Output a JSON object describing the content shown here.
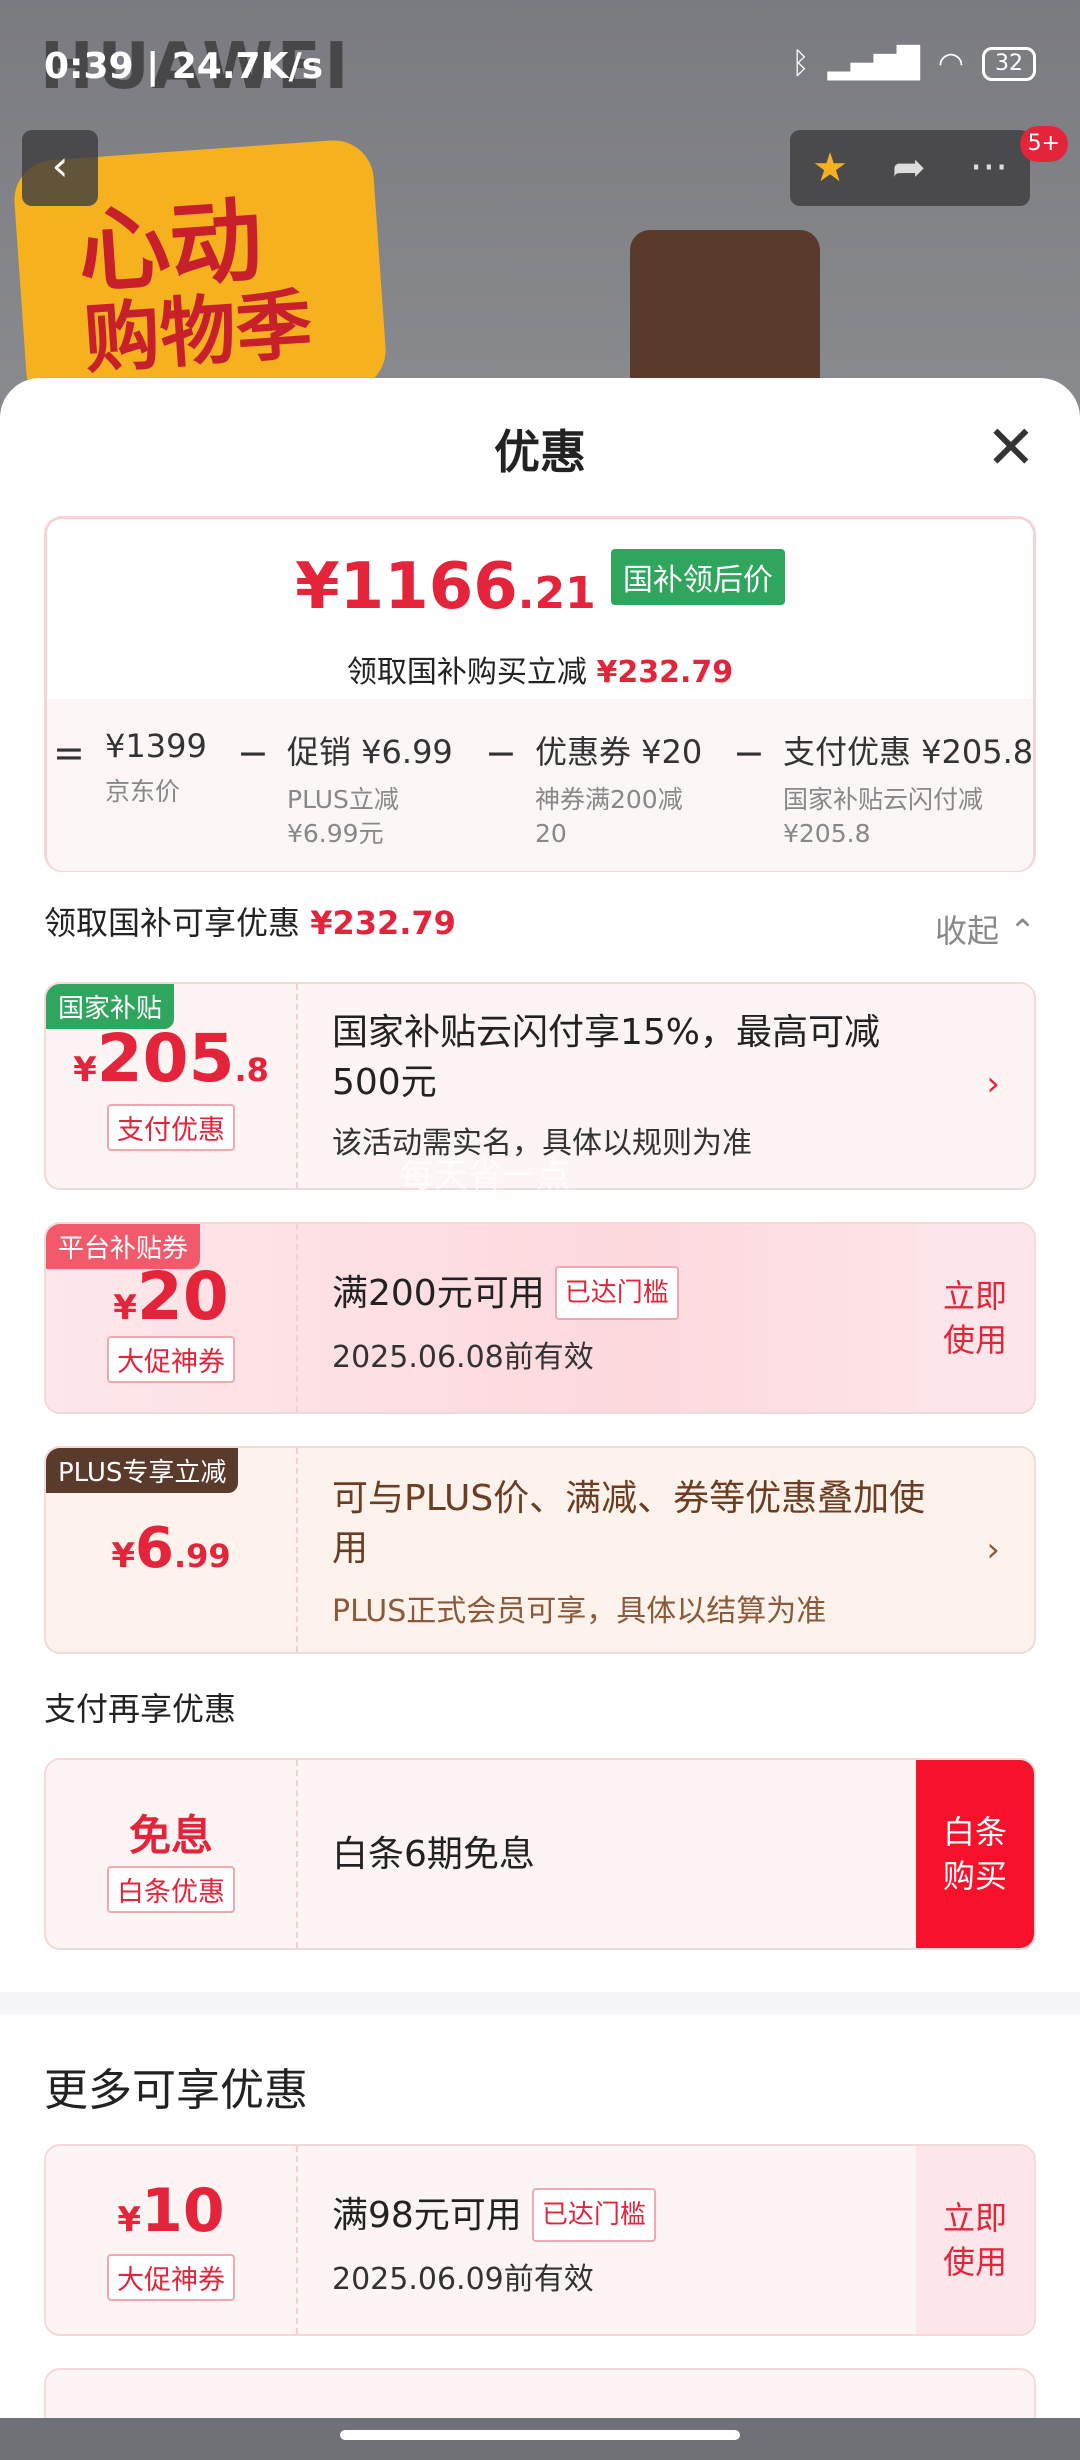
{
  "status": {
    "time": "0:39 | 24.7K/s",
    "battery": "32"
  },
  "background": {
    "brand": "HUAWEI",
    "promo_line1": "心动",
    "promo_line2": "购物季"
  },
  "nav": {
    "back": "‹",
    "more": "···",
    "badge": "5+"
  },
  "sheet": {
    "title": "优惠",
    "close": "✕"
  },
  "price": {
    "currency": "¥",
    "int": "1166",
    "dec": ".21",
    "tag": "国补领后价",
    "sub_text": "领取国补购买立减",
    "sub_amount": "¥232.79"
  },
  "breakdown": [
    {
      "label": "¥1399",
      "desc": "京东价"
    },
    {
      "label": "促销 ¥6.99",
      "desc": "PLUS立减\n¥6.99元"
    },
    {
      "label": "优惠券 ¥20",
      "desc": "神券满200减\n20"
    },
    {
      "label": "支付优惠 ¥205.8",
      "desc": "国家补贴云闪付减\n¥205.8"
    }
  ],
  "section1": {
    "label": "领取国补可享优惠",
    "amount": "¥232.79",
    "collapse": "收起 ⌃"
  },
  "cards": [
    {
      "corner": "国家补贴",
      "yen": "¥",
      "num": "205",
      "cents": ".8",
      "chip": "支付优惠",
      "title": "国家补贴云闪付享15%，最高可减\n500元",
      "desc": "该活动需实名，具体以规则为准",
      "watermark": "每天省一点"
    },
    {
      "corner": "平台补贴券",
      "yen": "¥",
      "num": "20",
      "cents": "",
      "chip": "大促神券",
      "title": "满200元可用",
      "reached": "已达门槛",
      "desc": "2025.06.08前有效",
      "use": "立即\n使用"
    },
    {
      "corner": "PLUS专享立减",
      "yen": "¥",
      "num": "6",
      "cents": ".99",
      "chip": "",
      "title": "可与PLUS价、满减、券等优惠叠加使\n用",
      "desc": "PLUS正式会员可享，具体以结算为准"
    }
  ],
  "section2": {
    "label": "支付再享优惠"
  },
  "baitiao": {
    "main": "免息",
    "chip": "白条优惠",
    "title": "白条6期免息",
    "use": "白条\n购买"
  },
  "more": {
    "title": "更多可享优惠",
    "card": {
      "yen": "¥",
      "num": "10",
      "chip": "大促神券",
      "title": "满98元可用",
      "reached": "已达门槛",
      "desc": "2025.06.09前有效",
      "use": "立即\n使用"
    }
  },
  "colors": {
    "accent": "#e4243a",
    "green_tag": "#2fa55e",
    "plus_brown": "#5a3a2a"
  }
}
